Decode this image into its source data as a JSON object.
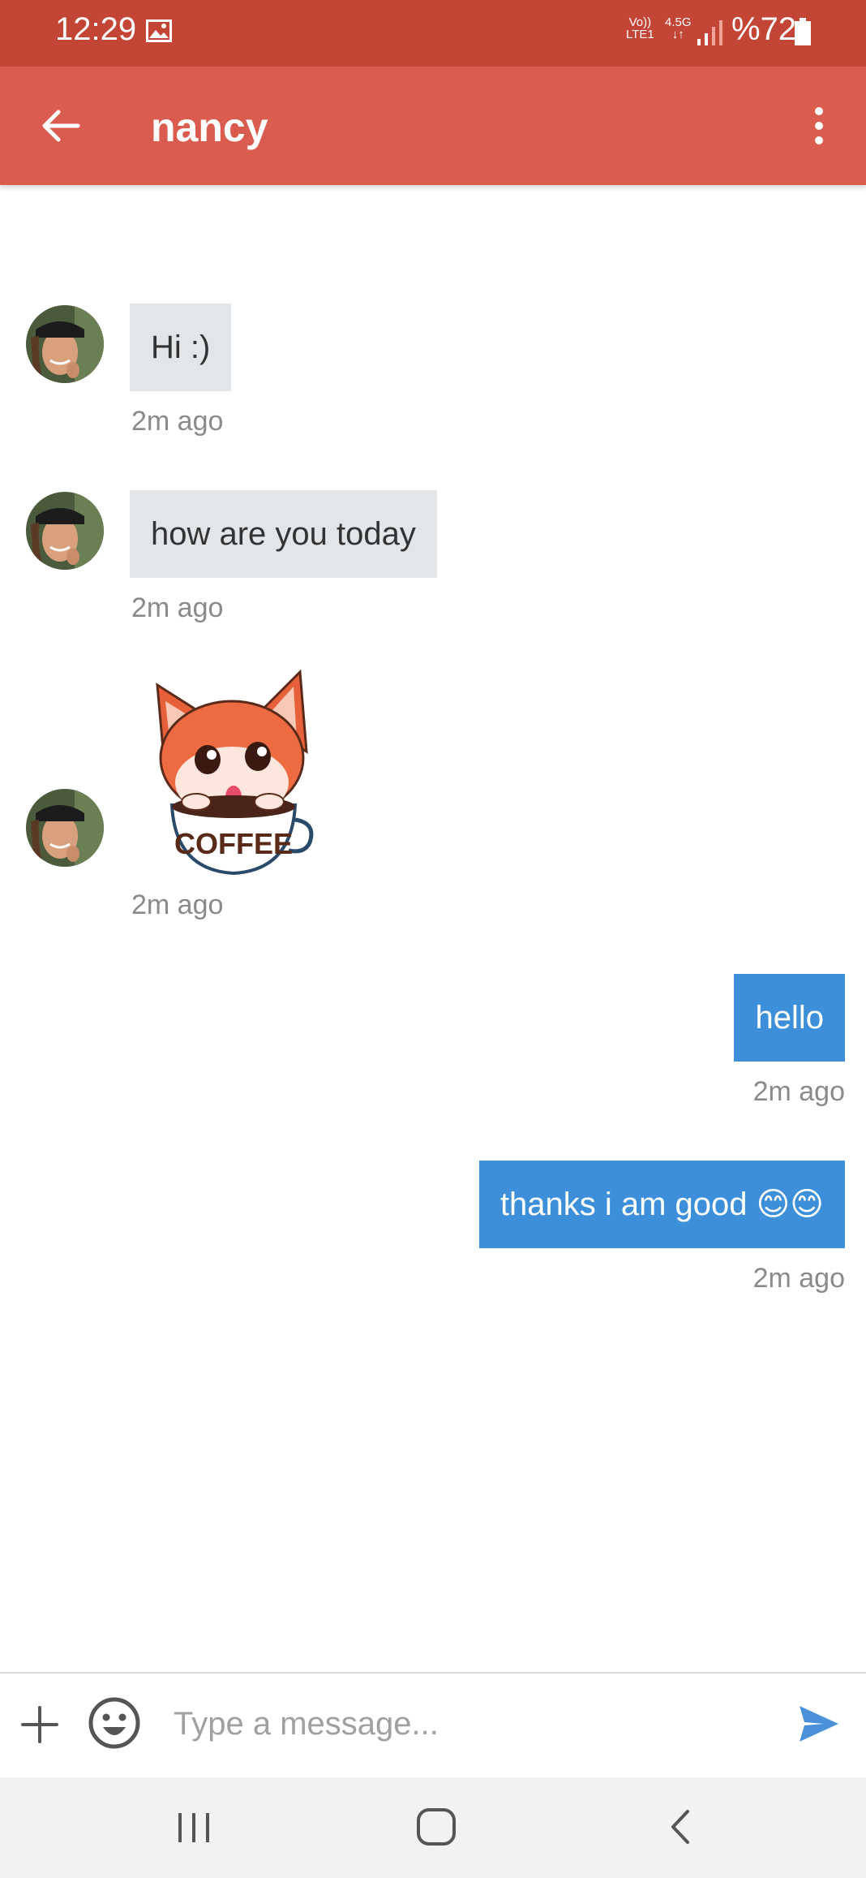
{
  "status_bar": {
    "time": "12:29",
    "volte_top": "Vo))",
    "volte_bottom": "LTE1",
    "network": "4.5G",
    "network_arrows": "↓↑",
    "battery": "%72"
  },
  "header": {
    "title": "nancy",
    "back_icon": "arrow-left-icon",
    "menu_icon": "more-vertical-icon"
  },
  "messages": [
    {
      "direction": "incoming",
      "type": "text",
      "text": "Hi :)",
      "time": "2m ago"
    },
    {
      "direction": "incoming",
      "type": "text",
      "text": "how are you today",
      "time": "2m ago"
    },
    {
      "direction": "incoming",
      "type": "sticker",
      "sticker_text": "COFFEE",
      "time": "2m ago"
    },
    {
      "direction": "outgoing",
      "type": "text",
      "text": "hello",
      "time": "2m ago"
    },
    {
      "direction": "outgoing",
      "type": "text",
      "text": "thanks i am good 😊😊",
      "time": "2m ago"
    }
  ],
  "composer": {
    "placeholder": "Type a message...",
    "value": ""
  },
  "colors": {
    "status_bar": "#c24535",
    "app_bar": "#d95c4f",
    "incoming_bubble": "#e3e6e8",
    "outgoing_bubble": "#3d8fd9",
    "send_icon": "#4a90d9"
  }
}
